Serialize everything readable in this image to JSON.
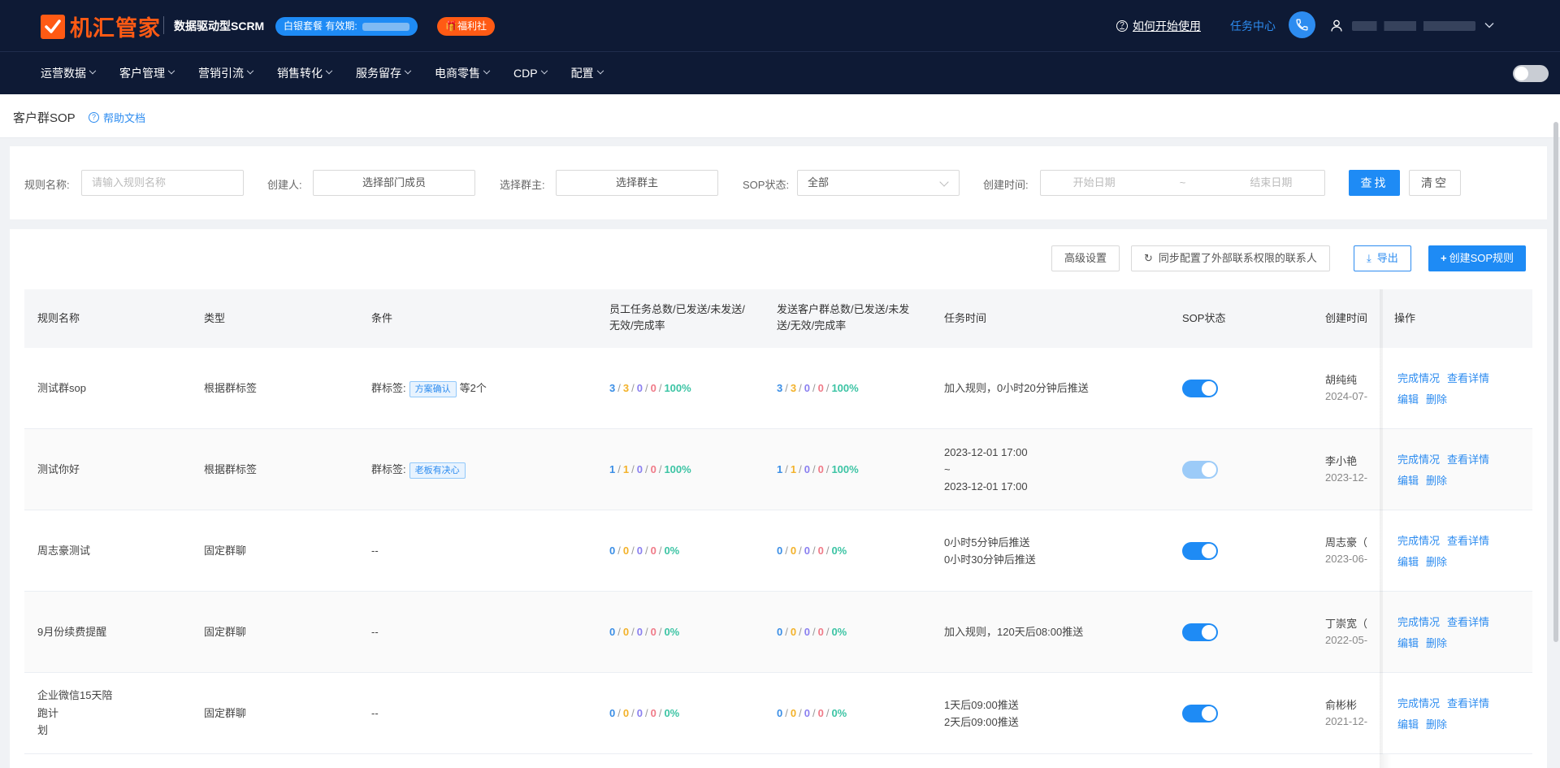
{
  "header": {
    "logo_text": "机汇管家",
    "subtitle": "数据驱动型SCRM",
    "plan_badge": "白银套餐 有效期:",
    "welfare_badge": "🎁福利社",
    "help_link": "如何开始使用",
    "task_center": "任务中心"
  },
  "nav": {
    "items": [
      "运营数据",
      "客户管理",
      "营销引流",
      "销售转化",
      "服务留存",
      "电商零售",
      "CDP",
      "配置"
    ]
  },
  "page": {
    "title": "客户群SOP",
    "help_doc": "帮助文档"
  },
  "filters": {
    "rule_name_label": "规则名称:",
    "rule_name_placeholder": "请输入规则名称",
    "creator_label": "创建人:",
    "creator_value": "选择部门成员",
    "owner_label": "选择群主:",
    "owner_value": "选择群主",
    "status_label": "SOP状态:",
    "status_value": "全部",
    "time_label": "创建时间:",
    "start_placeholder": "开始日期",
    "range_sep": "~",
    "end_placeholder": "结束日期",
    "search_btn": "查找",
    "clear_btn": "清空"
  },
  "toolbar": {
    "advanced": "高级设置",
    "sync": "同步配置了外部联系权限的联系人",
    "export": "导出",
    "create": "创建SOP规则"
  },
  "table": {
    "headers": {
      "name": "规则名称",
      "type": "类型",
      "condition": "条件",
      "staff_stats": "员工任务总数/已发送/未发送/无效/完成率",
      "group_stats": "发送客户群总数/已发送/未发送/无效/完成率",
      "task_time": "任务时间",
      "status": "SOP状态",
      "created": "创建时间",
      "actions": "操作"
    },
    "rows": [
      {
        "name": "测试群sop",
        "type": "根据群标签",
        "cond_label": "群标签:",
        "cond_tag": "方案确认",
        "cond_more": "等2个",
        "staff": [
          "3",
          "3",
          "0",
          "0",
          "100%"
        ],
        "group": [
          "3",
          "3",
          "0",
          "0",
          "100%"
        ],
        "time_line1": "加入规则，0小时20分钟后推送",
        "time_line2": "",
        "time_line3": "",
        "status_on": true,
        "creator": "胡纯纯",
        "created_date": "2024-07-",
        "actions": [
          "完成情况",
          "查看详情",
          "编辑",
          "删除"
        ]
      },
      {
        "name": "测试你好",
        "type": "根据群标签",
        "cond_label": "群标签:",
        "cond_tag": "老板有决心",
        "cond_more": "",
        "staff": [
          "1",
          "1",
          "0",
          "0",
          "100%"
        ],
        "group": [
          "1",
          "1",
          "0",
          "0",
          "100%"
        ],
        "time_line1": "2023-12-01 17:00",
        "time_line2": "~",
        "time_line3": "2023-12-01 17:00",
        "status_on": true,
        "creator": "李小艳",
        "created_date": "2023-12-",
        "actions": [
          "完成情况",
          "查看详情",
          "编辑",
          "删除"
        ]
      },
      {
        "name": "周志豪测试",
        "type": "固定群聊",
        "cond_text": "--",
        "staff": [
          "0",
          "0",
          "0",
          "0",
          "0%"
        ],
        "group": [
          "0",
          "0",
          "0",
          "0",
          "0%"
        ],
        "time_line1": "0小时5分钟后推送",
        "time_line2": "0小时30分钟后推送",
        "status_on": true,
        "creator": "周志豪（",
        "created_date": "2023-06-",
        "actions": [
          "完成情况",
          "查看详情",
          "编辑",
          "删除"
        ]
      },
      {
        "name": "9月份续费提醒",
        "type": "固定群聊",
        "cond_text": "--",
        "staff": [
          "0",
          "0",
          "0",
          "0",
          "0%"
        ],
        "group": [
          "0",
          "0",
          "0",
          "0",
          "0%"
        ],
        "time_line1": "加入规则，120天后08:00推送",
        "status_on": true,
        "creator": "丁崇宽（",
        "created_date": "2022-05-",
        "actions": [
          "完成情况",
          "查看详情",
          "编辑",
          "删除"
        ]
      },
      {
        "name_line1": "企业微信15天陪",
        "name_line2": "跑计",
        "name_line3": "划",
        "type": "固定群聊",
        "cond_text": "--",
        "staff": [
          "0",
          "0",
          "0",
          "0",
          "0%"
        ],
        "group": [
          "0",
          "0",
          "0",
          "0",
          "0%"
        ],
        "time_line1": "1天后09:00推送",
        "time_line2": "2天后09:00推送",
        "status_on": true,
        "creator": "俞彬彬",
        "created_date": "2021-12-",
        "actions": [
          "完成情况",
          "查看详情",
          "编辑",
          "删除"
        ]
      }
    ]
  },
  "colors": {
    "nav_bg": "#0e1a35",
    "brand_orange": "#ff5a14",
    "primary_blue": "#1e8bf5"
  }
}
